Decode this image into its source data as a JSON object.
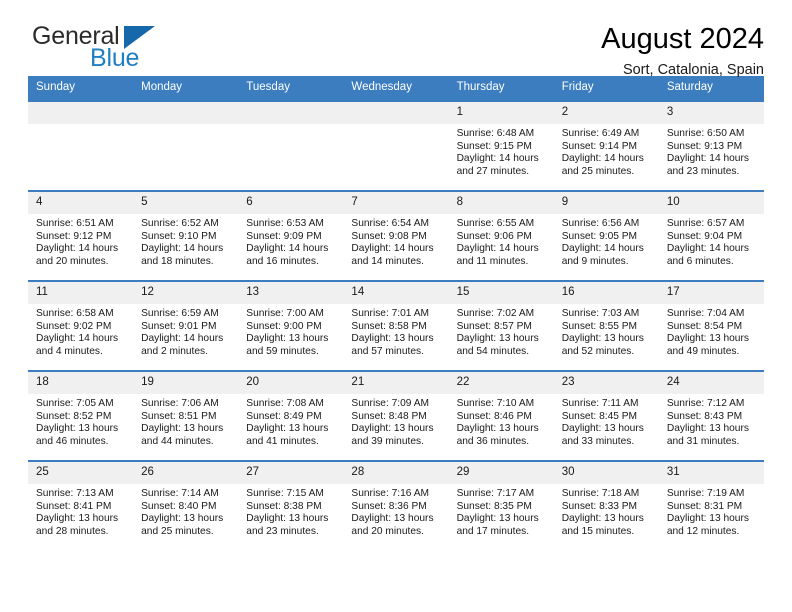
{
  "brand": {
    "line1": "General",
    "line2": "Blue",
    "accent_color": "#1f7fc4",
    "triangle_color": "#1768aa"
  },
  "header": {
    "title": "August 2024",
    "subtitle": "Sort, Catalonia, Spain",
    "header_band_color": "#3b7dbf",
    "number_strip_color": "#f0f0f0"
  },
  "weekdays": [
    "Sunday",
    "Monday",
    "Tuesday",
    "Wednesday",
    "Thursday",
    "Friday",
    "Saturday"
  ],
  "labels": {
    "sunrise": "Sunrise:",
    "sunset": "Sunset:",
    "daylight": "Daylight:"
  },
  "weeks": [
    [
      {
        "day": "",
        "blank": true
      },
      {
        "day": "",
        "blank": true
      },
      {
        "day": "",
        "blank": true
      },
      {
        "day": "",
        "blank": true
      },
      {
        "day": "1",
        "sunrise": "Sunrise: 6:48 AM",
        "sunset": "Sunset: 9:15 PM",
        "daylight1": "Daylight: 14 hours",
        "daylight2": "and 27 minutes."
      },
      {
        "day": "2",
        "sunrise": "Sunrise: 6:49 AM",
        "sunset": "Sunset: 9:14 PM",
        "daylight1": "Daylight: 14 hours",
        "daylight2": "and 25 minutes."
      },
      {
        "day": "3",
        "sunrise": "Sunrise: 6:50 AM",
        "sunset": "Sunset: 9:13 PM",
        "daylight1": "Daylight: 14 hours",
        "daylight2": "and 23 minutes."
      }
    ],
    [
      {
        "day": "4",
        "sunrise": "Sunrise: 6:51 AM",
        "sunset": "Sunset: 9:12 PM",
        "daylight1": "Daylight: 14 hours",
        "daylight2": "and 20 minutes."
      },
      {
        "day": "5",
        "sunrise": "Sunrise: 6:52 AM",
        "sunset": "Sunset: 9:10 PM",
        "daylight1": "Daylight: 14 hours",
        "daylight2": "and 18 minutes."
      },
      {
        "day": "6",
        "sunrise": "Sunrise: 6:53 AM",
        "sunset": "Sunset: 9:09 PM",
        "daylight1": "Daylight: 14 hours",
        "daylight2": "and 16 minutes."
      },
      {
        "day": "7",
        "sunrise": "Sunrise: 6:54 AM",
        "sunset": "Sunset: 9:08 PM",
        "daylight1": "Daylight: 14 hours",
        "daylight2": "and 14 minutes."
      },
      {
        "day": "8",
        "sunrise": "Sunrise: 6:55 AM",
        "sunset": "Sunset: 9:06 PM",
        "daylight1": "Daylight: 14 hours",
        "daylight2": "and 11 minutes."
      },
      {
        "day": "9",
        "sunrise": "Sunrise: 6:56 AM",
        "sunset": "Sunset: 9:05 PM",
        "daylight1": "Daylight: 14 hours",
        "daylight2": "and 9 minutes."
      },
      {
        "day": "10",
        "sunrise": "Sunrise: 6:57 AM",
        "sunset": "Sunset: 9:04 PM",
        "daylight1": "Daylight: 14 hours",
        "daylight2": "and 6 minutes."
      }
    ],
    [
      {
        "day": "11",
        "sunrise": "Sunrise: 6:58 AM",
        "sunset": "Sunset: 9:02 PM",
        "daylight1": "Daylight: 14 hours",
        "daylight2": "and 4 minutes."
      },
      {
        "day": "12",
        "sunrise": "Sunrise: 6:59 AM",
        "sunset": "Sunset: 9:01 PM",
        "daylight1": "Daylight: 14 hours",
        "daylight2": "and 2 minutes."
      },
      {
        "day": "13",
        "sunrise": "Sunrise: 7:00 AM",
        "sunset": "Sunset: 9:00 PM",
        "daylight1": "Daylight: 13 hours",
        "daylight2": "and 59 minutes."
      },
      {
        "day": "14",
        "sunrise": "Sunrise: 7:01 AM",
        "sunset": "Sunset: 8:58 PM",
        "daylight1": "Daylight: 13 hours",
        "daylight2": "and 57 minutes."
      },
      {
        "day": "15",
        "sunrise": "Sunrise: 7:02 AM",
        "sunset": "Sunset: 8:57 PM",
        "daylight1": "Daylight: 13 hours",
        "daylight2": "and 54 minutes."
      },
      {
        "day": "16",
        "sunrise": "Sunrise: 7:03 AM",
        "sunset": "Sunset: 8:55 PM",
        "daylight1": "Daylight: 13 hours",
        "daylight2": "and 52 minutes."
      },
      {
        "day": "17",
        "sunrise": "Sunrise: 7:04 AM",
        "sunset": "Sunset: 8:54 PM",
        "daylight1": "Daylight: 13 hours",
        "daylight2": "and 49 minutes."
      }
    ],
    [
      {
        "day": "18",
        "sunrise": "Sunrise: 7:05 AM",
        "sunset": "Sunset: 8:52 PM",
        "daylight1": "Daylight: 13 hours",
        "daylight2": "and 46 minutes."
      },
      {
        "day": "19",
        "sunrise": "Sunrise: 7:06 AM",
        "sunset": "Sunset: 8:51 PM",
        "daylight1": "Daylight: 13 hours",
        "daylight2": "and 44 minutes."
      },
      {
        "day": "20",
        "sunrise": "Sunrise: 7:08 AM",
        "sunset": "Sunset: 8:49 PM",
        "daylight1": "Daylight: 13 hours",
        "daylight2": "and 41 minutes."
      },
      {
        "day": "21",
        "sunrise": "Sunrise: 7:09 AM",
        "sunset": "Sunset: 8:48 PM",
        "daylight1": "Daylight: 13 hours",
        "daylight2": "and 39 minutes."
      },
      {
        "day": "22",
        "sunrise": "Sunrise: 7:10 AM",
        "sunset": "Sunset: 8:46 PM",
        "daylight1": "Daylight: 13 hours",
        "daylight2": "and 36 minutes."
      },
      {
        "day": "23",
        "sunrise": "Sunrise: 7:11 AM",
        "sunset": "Sunset: 8:45 PM",
        "daylight1": "Daylight: 13 hours",
        "daylight2": "and 33 minutes."
      },
      {
        "day": "24",
        "sunrise": "Sunrise: 7:12 AM",
        "sunset": "Sunset: 8:43 PM",
        "daylight1": "Daylight: 13 hours",
        "daylight2": "and 31 minutes."
      }
    ],
    [
      {
        "day": "25",
        "sunrise": "Sunrise: 7:13 AM",
        "sunset": "Sunset: 8:41 PM",
        "daylight1": "Daylight: 13 hours",
        "daylight2": "and 28 minutes."
      },
      {
        "day": "26",
        "sunrise": "Sunrise: 7:14 AM",
        "sunset": "Sunset: 8:40 PM",
        "daylight1": "Daylight: 13 hours",
        "daylight2": "and 25 minutes."
      },
      {
        "day": "27",
        "sunrise": "Sunrise: 7:15 AM",
        "sunset": "Sunset: 8:38 PM",
        "daylight1": "Daylight: 13 hours",
        "daylight2": "and 23 minutes."
      },
      {
        "day": "28",
        "sunrise": "Sunrise: 7:16 AM",
        "sunset": "Sunset: 8:36 PM",
        "daylight1": "Daylight: 13 hours",
        "daylight2": "and 20 minutes."
      },
      {
        "day": "29",
        "sunrise": "Sunrise: 7:17 AM",
        "sunset": "Sunset: 8:35 PM",
        "daylight1": "Daylight: 13 hours",
        "daylight2": "and 17 minutes."
      },
      {
        "day": "30",
        "sunrise": "Sunrise: 7:18 AM",
        "sunset": "Sunset: 8:33 PM",
        "daylight1": "Daylight: 13 hours",
        "daylight2": "and 15 minutes."
      },
      {
        "day": "31",
        "sunrise": "Sunrise: 7:19 AM",
        "sunset": "Sunset: 8:31 PM",
        "daylight1": "Daylight: 13 hours",
        "daylight2": "and 12 minutes."
      }
    ]
  ]
}
